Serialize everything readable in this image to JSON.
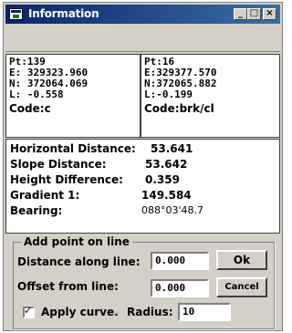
{
  "window": {
    "title": "Information",
    "controls": {
      "minimize": "_",
      "maximize": "□",
      "close": "×"
    }
  },
  "point1": {
    "pt": "Pt:139",
    "e": "E: 329323.960",
    "n": "N: 372064.069",
    "l": "L: -0.558",
    "code": "Code:c"
  },
  "point2": {
    "pt": "Pt:16",
    "e": "E:329377.570",
    "n": "N:372065.882",
    "l": "L:-0.199",
    "code": "Code:brk/cl"
  },
  "results": {
    "horizontal": {
      "label": "Horizontal Distance:",
      "value": "53.641"
    },
    "slope": {
      "label": "Slope Distance:",
      "value": "53.642"
    },
    "height": {
      "label": "Height Difference:",
      "value": "0.359"
    },
    "gradient": {
      "label": "Gradient 1:",
      "value": "149.584"
    },
    "bearing": {
      "label": "Bearing:",
      "value": "088°03'48.7"
    }
  },
  "add_point": {
    "legend": "Add point on line",
    "distance_label": "Distance along line:",
    "distance_value": "0.000",
    "offset_label": "Offset from line:",
    "offset_value": "0.000",
    "ok_label": "Ok",
    "cancel_label": "Cancel",
    "apply_curve_label": "Apply curve.",
    "apply_curve_checked": true,
    "radius_label": "Radius:",
    "radius_value": "10"
  }
}
